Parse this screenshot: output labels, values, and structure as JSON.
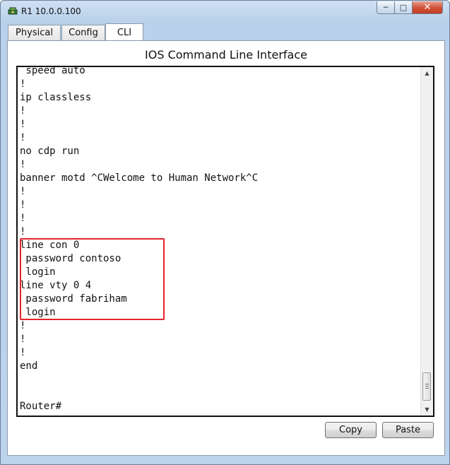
{
  "window": {
    "title": "R1 10.0.0.100",
    "icon": "router-icon",
    "controls": {
      "minimize": "─",
      "maximize": "□",
      "close": "✕"
    }
  },
  "tabs": [
    {
      "label": "Physical",
      "active": false
    },
    {
      "label": "Config",
      "active": false
    },
    {
      "label": "CLI",
      "active": true
    }
  ],
  "panel": {
    "title": "IOS Command Line Interface"
  },
  "terminal": {
    "lines": [
      " speed auto",
      "!",
      "ip classless",
      "!",
      "!",
      "!",
      "no cdp run",
      "!",
      "banner motd ^CWelcome to Human Network^C",
      "!",
      "!",
      "!",
      "!",
      "line con 0",
      " password contoso",
      " login",
      "line vty 0 4",
      " password fabriham",
      " login",
      "!",
      "!",
      "!",
      "end",
      "",
      "",
      "Router#"
    ],
    "highlight_color": "#e5252b"
  },
  "buttons": {
    "copy": "Copy",
    "paste": "Paste"
  }
}
